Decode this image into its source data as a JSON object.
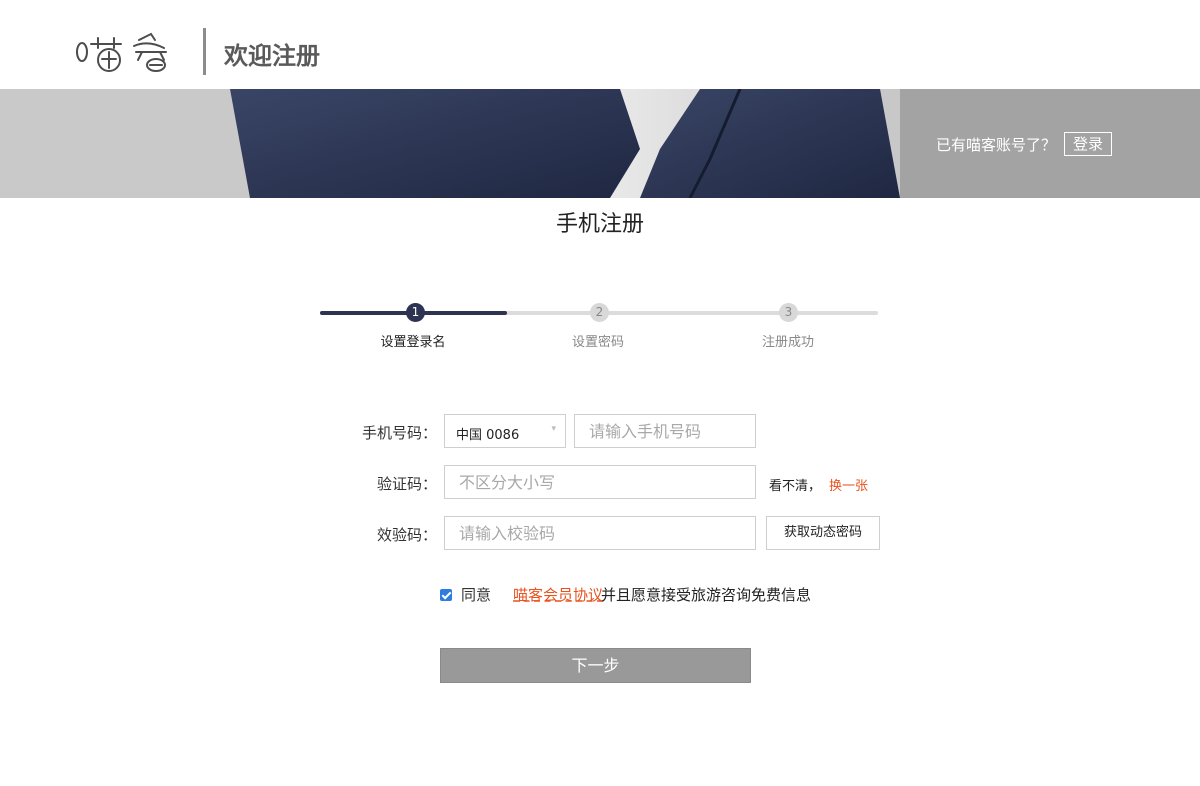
{
  "header": {
    "logo_alt": "喵客",
    "title": "欢迎注册"
  },
  "banner": {
    "has_account_text": "已有喵客账号了？",
    "login_label": "登录"
  },
  "page_title": "手机注册",
  "stepper": {
    "current": 1,
    "steps": [
      {
        "number": "1",
        "label": "设置登录名"
      },
      {
        "number": "2",
        "label": "设置密码"
      },
      {
        "number": "3",
        "label": "注册成功"
      }
    ]
  },
  "form": {
    "phone": {
      "label": "手机号码：",
      "country_value": "中国  0086",
      "placeholder": "请输入手机号码"
    },
    "captcha": {
      "label": "验证码：",
      "placeholder": "不区分大小写",
      "hint": "看不清，",
      "refresh_label": "换一张"
    },
    "sms": {
      "label": "效验码：",
      "placeholder": "请输入校验码",
      "button_label": "获取动态密码"
    }
  },
  "agreement": {
    "checked": true,
    "agree_label": "同意",
    "protocol_label": "喵客会员协议",
    "suffix": "并且愿意接受旅游咨询免费信息"
  },
  "next_label": "下一步",
  "colors": {
    "accent": "#2d3350",
    "link": "#e8531f",
    "checkbox": "#2e7ce0",
    "button_disabled": "#999999"
  }
}
